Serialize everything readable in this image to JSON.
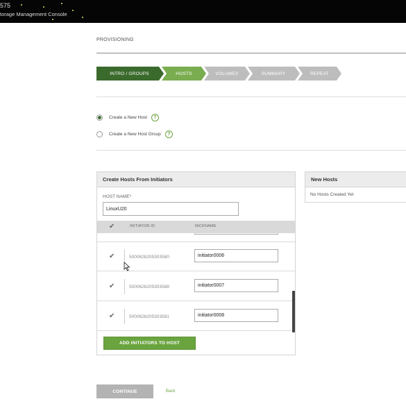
{
  "header": {
    "model_number": "575",
    "product_name": "torage Management Console"
  },
  "page": {
    "section_title": "PROVISIONING"
  },
  "wizard": {
    "steps": [
      {
        "label": "INTRO / GROUPS",
        "state": "done"
      },
      {
        "label": "HOSTS",
        "state": "active"
      },
      {
        "label": "VOLUMES",
        "state": "todo"
      },
      {
        "label": "SUMMARY",
        "state": "todo"
      },
      {
        "label": "REPEAT",
        "state": "todo"
      }
    ]
  },
  "options": {
    "create_host": {
      "label": "Create a New Host",
      "selected": true
    },
    "create_host_group": {
      "label": "Create a New Host Group",
      "selected": false
    },
    "help_glyph": "?"
  },
  "create_panel": {
    "title": "Create Hosts From Initiators",
    "host_name_label": "HOST NAME*",
    "host_name_value": "LinuxU20",
    "columns": {
      "initiator_id": "INITIATOR ID",
      "nickname": "NICKNAME"
    },
    "rows": [
      {
        "initiator_id": "500062b205303580",
        "nickname": "initiator0006",
        "checked": true
      },
      {
        "initiator_id": "500062b205303588",
        "nickname": "initiator0007",
        "checked": true
      },
      {
        "initiator_id": "500062b205303581",
        "nickname": "initiator0008",
        "checked": true
      }
    ],
    "add_button_label": "ADD INITIATORS TO HOST"
  },
  "new_hosts_panel": {
    "title": "New Hosts",
    "empty_text": "No Hosts Created Yet"
  },
  "footer": {
    "continue_label": "CONTINUE",
    "back_label": "Back"
  },
  "colors": {
    "step_done": "#3b6a2d",
    "step_active": "#79ad4f",
    "step_todo": "#bdbdbd",
    "accent_green": "#6aa43f"
  }
}
